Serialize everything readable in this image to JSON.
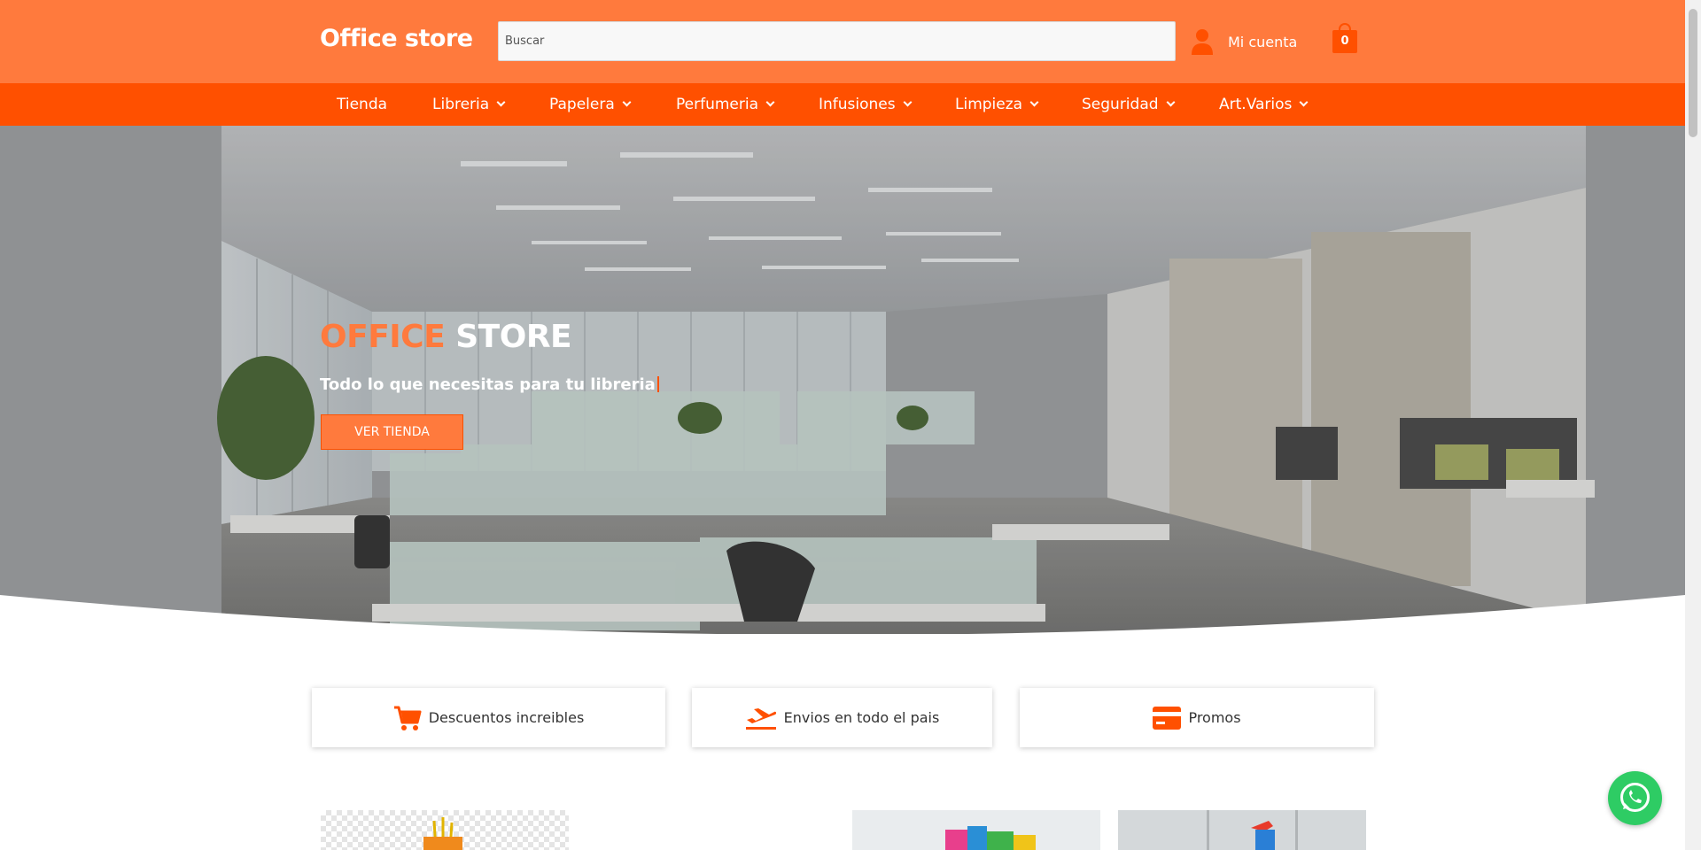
{
  "header": {
    "logo": "Office store",
    "search_placeholder": "Buscar",
    "account_label": "Mi cuenta",
    "cart_count": "0"
  },
  "nav": [
    {
      "label": "Tienda",
      "dropdown": false
    },
    {
      "label": "Libreria",
      "dropdown": true
    },
    {
      "label": "Papelera",
      "dropdown": true
    },
    {
      "label": "Perfumeria",
      "dropdown": true
    },
    {
      "label": "Infusiones",
      "dropdown": true
    },
    {
      "label": "Limpieza",
      "dropdown": true
    },
    {
      "label": "Seguridad",
      "dropdown": true
    },
    {
      "label": "Art.Varios",
      "dropdown": true
    }
  ],
  "hero": {
    "title_highlight": "OFFICE",
    "title_rest": "STORE",
    "subtitle": "Todo lo que necesitas para tu libreria",
    "button": "VER TIENDA"
  },
  "features": [
    {
      "label": "Descuentos increibles",
      "icon": "cart-icon"
    },
    {
      "label": "Envios en todo el pais",
      "icon": "airplane-icon"
    },
    {
      "label": "Promos",
      "icon": "credit-card-icon"
    }
  ],
  "colors": {
    "header": "#ff7a3d",
    "nav": "#ff5000",
    "accent": "#ff5000",
    "whatsapp": "#2ecc64"
  }
}
